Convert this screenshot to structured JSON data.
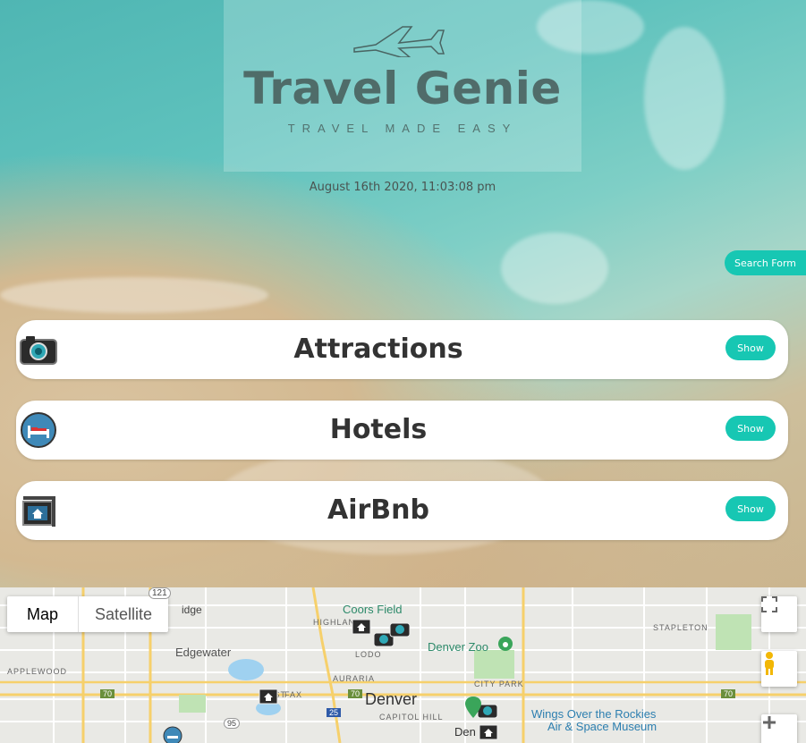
{
  "header": {
    "logo_title": "Travel Genie",
    "logo_tagline": "TRAVEL MADE EASY",
    "datetime": "August 16th 2020, 11:03:08 pm",
    "search_form_button": "Search Form"
  },
  "cards": [
    {
      "title": "Attractions",
      "icon": "camera-icon",
      "button": "Show"
    },
    {
      "title": "Hotels",
      "icon": "bed-icon",
      "button": "Show"
    },
    {
      "title": "AirBnb",
      "icon": "house-sign-icon",
      "button": "Show"
    }
  ],
  "map": {
    "type_map": "Map",
    "type_satellite": "Satellite",
    "labels": {
      "coors_field": "Coors Field",
      "highland": "HIGHLAN",
      "edgewater": "Edgewater",
      "applewood": "APPLEWOOD",
      "denver_zoo": "Denver Zoo",
      "stapleton": "STAPLETON",
      "lodo": "LODO",
      "auraria": "AURARIA",
      "west_colfax": "WEST",
      "colfax": "FAX",
      "denver": "Denver",
      "city_park": "CITY PARK",
      "capitol_hill": "CAPITOL HILL",
      "wings_1": "Wings Over the Rockies",
      "wings_2": "Air & Space Museum",
      "den": "Den",
      "idge": "idge",
      "hwy_121": "121",
      "hwy_70a": "70",
      "hwy_70b": "70",
      "hwy_70c": "70",
      "hwy_25": "25",
      "hwy_95": "95"
    },
    "colors": {
      "highway": "#f6d06b",
      "water": "#9fd1f0",
      "park": "#bfe3b4",
      "accent": "#17c7b3"
    }
  }
}
